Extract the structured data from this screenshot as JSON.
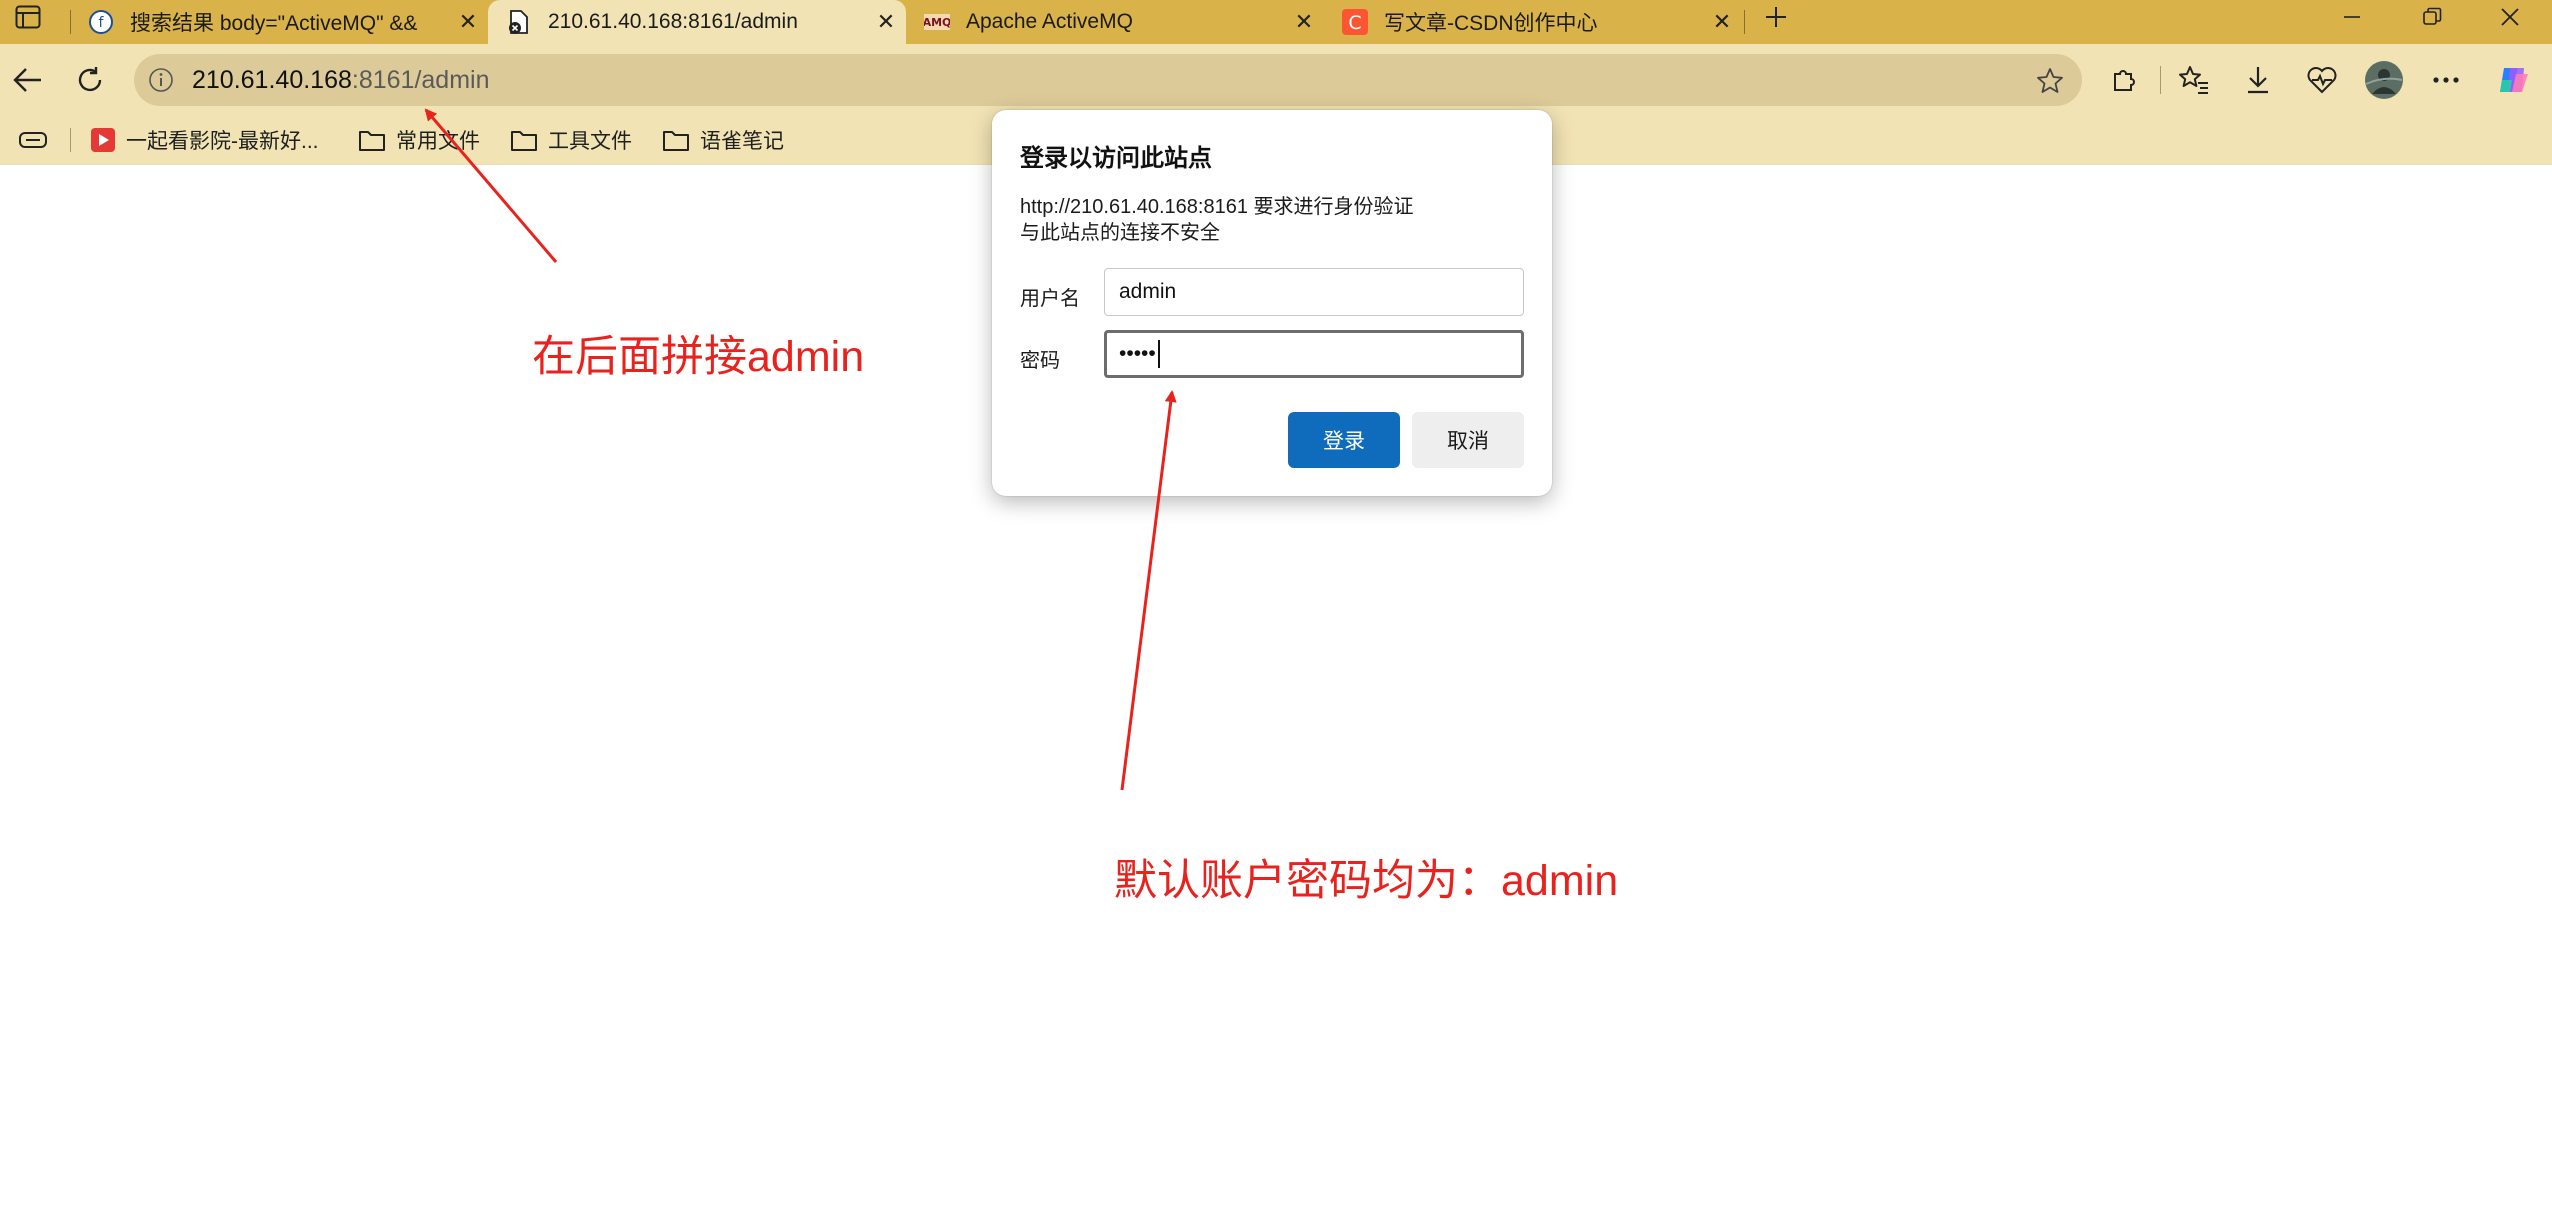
{
  "tabs": [
    {
      "title": "搜索结果 body=\"ActiveMQ\" &&",
      "active": false
    },
    {
      "title": "210.61.40.168:8161/admin",
      "active": true
    },
    {
      "title": "Apache ActiveMQ",
      "active": false
    },
    {
      "title": "写文章-CSDN创作中心",
      "active": false
    }
  ],
  "tab_favicons": {
    "amq": "AMQ",
    "csdn": "C"
  },
  "toolbar": {
    "url_host": "210.61.40.168",
    "url_rest": ":8161/admin"
  },
  "bookmarks": [
    {
      "label": "一起看影院-最新好...",
      "icon": "video-icon"
    },
    {
      "label": "常用文件",
      "icon": "folder-icon"
    },
    {
      "label": "工具文件",
      "icon": "folder-icon"
    },
    {
      "label": "语雀笔记",
      "icon": "folder-icon"
    }
  ],
  "dialog": {
    "title": "登录以访问此站点",
    "message_line1": "http://210.61.40.168:8161 要求进行身份验证",
    "message_line2": "与此站点的连接不安全",
    "username_label": "用户名",
    "username_value": "admin",
    "password_label": "密码",
    "password_value": "•••••",
    "ok_label": "登录",
    "cancel_label": "取消"
  },
  "annotations": {
    "url_note": "在后面拼接admin",
    "credentials_note": "默认账户密码均为：admin",
    "color": "#e8231d"
  },
  "colors": {
    "tabstrip": "#d9b24a",
    "toolbar": "#f1e3b4",
    "omnibox": "#dccb98",
    "primary_button": "#0f6cbd"
  }
}
